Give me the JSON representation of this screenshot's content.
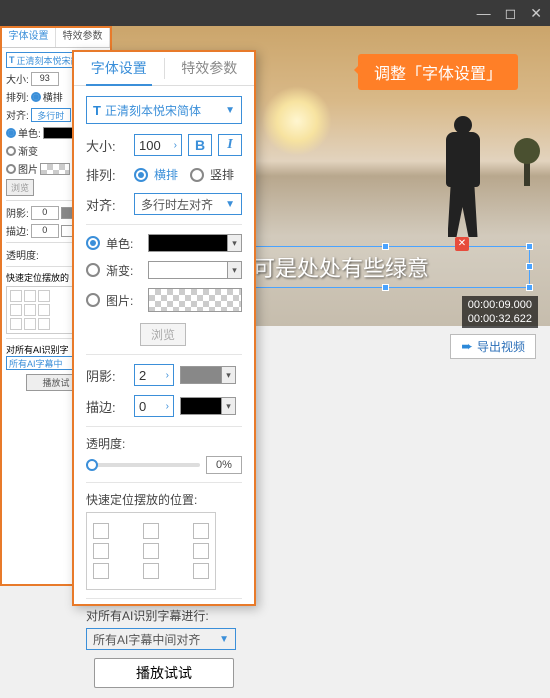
{
  "titlebar": {
    "min": "—",
    "max": "◻",
    "close": "✕"
  },
  "callout": "调整「字体设置」",
  "tabs": {
    "font": "字体设置",
    "effect": "特效参数"
  },
  "font_name": "正清刻本悦宋简体",
  "size": {
    "label": "大小:",
    "value": "100"
  },
  "bold": "B",
  "italic": "I",
  "arrange": {
    "label": "排列:",
    "h": "横排",
    "v": "竖排"
  },
  "align": {
    "label": "对齐:",
    "value": "多行时左对齐"
  },
  "fill": {
    "solid": "单色:",
    "gradient": "渐变:",
    "image": "图片:"
  },
  "browse": "浏览",
  "shadow": {
    "label": "阴影:",
    "value": "2"
  },
  "stroke": {
    "label": "描边:",
    "value": "0"
  },
  "opacity": {
    "label": "透明度:",
    "value": "0%"
  },
  "quickpos": "快速定位摆放的位置:",
  "ai_label": "对所有AI识别字幕进行:",
  "ai_value": "所有AI字幕中间对齐",
  "play": "播放试试",
  "subtitle": "可是处处有些绿意",
  "time": {
    "cur": "00:00:09.000",
    "dur": "00:00:32.622"
  },
  "export": "导出视频",
  "bg": {
    "size_label": "大小:",
    "size_val": "93",
    "arrange_label": "排列:",
    "align_label": "对齐:",
    "align_val": "多行时",
    "shadow_label": "阴影:",
    "shadow_val": "0",
    "stroke_label": "描边:",
    "stroke_val": "0",
    "opacity_label": "透明度:",
    "quickpos": "快速定位摆放的",
    "ai_label": "对所有AI识别字",
    "ai_val": "所有AI字幕中",
    "play": "播放试"
  }
}
